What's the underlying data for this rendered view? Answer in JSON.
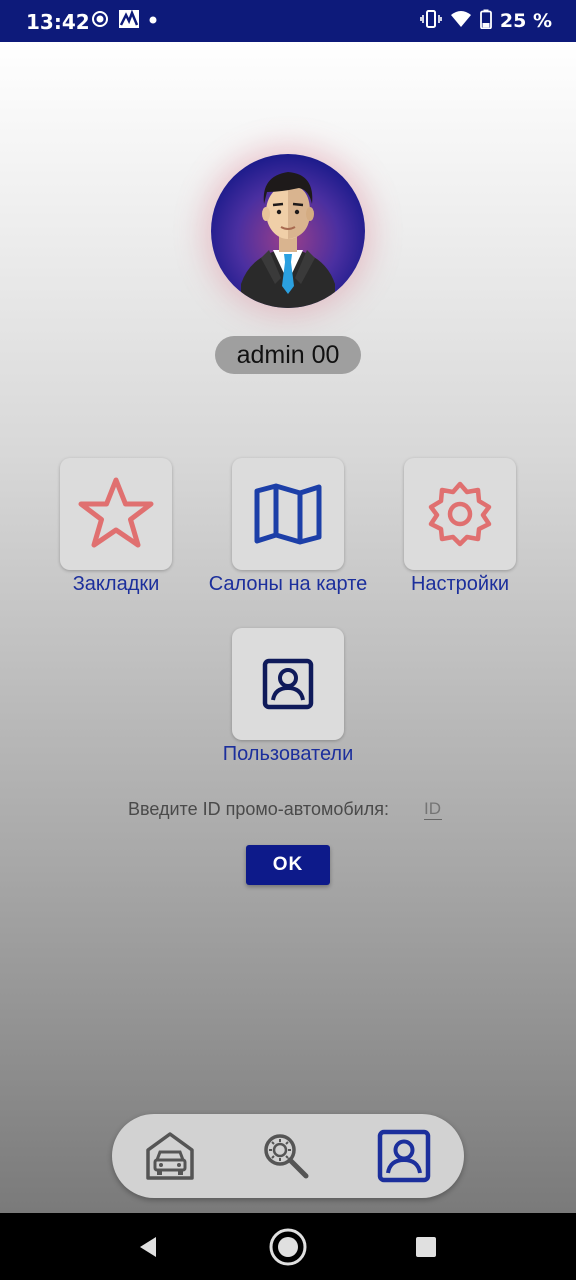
{
  "status_bar": {
    "time": "13:42",
    "battery_percent": "25 %",
    "left_icons": [
      "screen-record-icon",
      "app-notification-icon",
      "dot-icon"
    ],
    "right_icons": [
      "vibrate-icon",
      "wifi-icon",
      "battery-icon"
    ]
  },
  "profile": {
    "avatar": "businessman-avatar-icon",
    "username": "admin 00"
  },
  "menu": {
    "bookmarks_label": "Закладки",
    "salons_map_label": "Салоны на карте",
    "settings_label": "Настройки",
    "users_label": "Пользователи"
  },
  "promo": {
    "label": "Введите ID промо-автомобиля:",
    "placeholder": "ID",
    "ok_label": "OK"
  },
  "bottom_nav": {
    "items": [
      "garage-car-icon",
      "search-settings-icon",
      "profile-icon"
    ],
    "active": "profile-icon"
  },
  "colors": {
    "primary": "#0d1a8a",
    "label_blue": "#1c2f9c",
    "accent_red": "#e07070"
  }
}
